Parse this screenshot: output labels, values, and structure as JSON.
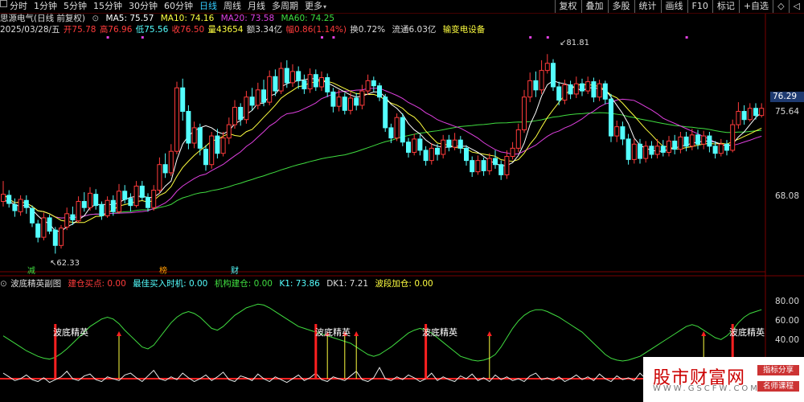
{
  "toolbar": {
    "periods": [
      "分时",
      "1分钟",
      "5分钟",
      "15分钟",
      "30分钟",
      "60分钟",
      "日线",
      "周线",
      "月线",
      "多周期",
      "更多"
    ],
    "active_period": "日线",
    "tools": [
      "复权",
      "叠加",
      "多股",
      "统计",
      "画线",
      "F10",
      "标记",
      "+自选",
      "◇",
      "◁"
    ]
  },
  "stock": {
    "name_line": "思源电气(日线 前复权)",
    "ma5_label": "MA5: 75.57",
    "ma10_label": "MA10: 74.16",
    "ma20_label": "MA20: 73.58",
    "ma60_label": "MA60: 74.25",
    "date": "2025/03/28/五",
    "open": "开75.78",
    "high": "高76.96",
    "low": "低75.56",
    "close": "收76.50",
    "volume": "量43654",
    "amount": "额3.34亿",
    "change": "幅0.86(1.14%)",
    "turnover": "换0.72%",
    "float_cap": "流通6.03亿",
    "sector": "输变电设备"
  },
  "main_axis": {
    "labels": [
      "75.64",
      "68.08"
    ],
    "current_price": "76.29"
  },
  "annotations": {
    "high_label": "81.81",
    "low_label": "62.33",
    "markers": [
      "减",
      "榜",
      "财"
    ]
  },
  "sub_panel": {
    "title": "波底精英副图",
    "items": [
      "建仓买点: 0.00",
      "最佳买入时机: 0.00",
      "机构建仓: 0.00",
      "K1: 73.86",
      "DK1: 7.21",
      "波段加仓: 0.00"
    ],
    "axis_labels": [
      "80.00",
      "60.00",
      "40.00"
    ],
    "signal_label": "波底精英"
  },
  "watermark": {
    "title": "股市财富网",
    "url": "WWW.GSCFW.COM",
    "badge1": "指标分享",
    "badge2": "名师课程"
  },
  "colors": {
    "up": "#ff3b3b",
    "down": "#54ffff",
    "ma5": "#ffffff",
    "ma10": "#ffff40",
    "ma20": "#e040e0",
    "ma60": "#40dd40"
  },
  "chart_data": {
    "type": "candlestick",
    "y_range_main": [
      61,
      83
    ],
    "y_range_sub": [
      0,
      100
    ],
    "candles": [
      [
        67.4,
        68.1,
        69.4,
        66.9
      ],
      [
        68.0,
        67.2,
        68.5,
        66.8
      ],
      [
        67.1,
        66.5,
        67.7,
        65.9
      ],
      [
        66.4,
        67.6,
        68.0,
        66.0
      ],
      [
        67.5,
        66.8,
        68.0,
        66.2
      ],
      [
        66.7,
        65.3,
        67.0,
        64.9
      ],
      [
        65.2,
        63.9,
        65.6,
        63.4
      ],
      [
        63.9,
        65.8,
        66.3,
        63.6
      ],
      [
        65.8,
        64.5,
        66.1,
        64.2
      ],
      [
        64.6,
        63.1,
        64.9,
        62.3
      ],
      [
        63.1,
        64.8,
        65.1,
        62.8
      ],
      [
        64.9,
        66.2,
        66.8,
        64.6
      ],
      [
        66.1,
        65.6,
        66.9,
        65.1
      ],
      [
        65.5,
        67.4,
        67.9,
        65.3
      ],
      [
        67.4,
        66.8,
        68.3,
        66.4
      ],
      [
        66.8,
        68.2,
        68.8,
        66.5
      ],
      [
        68.1,
        67.0,
        68.6,
        66.6
      ],
      [
        67.1,
        66.0,
        67.4,
        65.6
      ],
      [
        66.0,
        67.5,
        67.9,
        65.8
      ],
      [
        67.5,
        66.4,
        68.0,
        66.0
      ],
      [
        66.4,
        68.4,
        69.1,
        66.2
      ],
      [
        68.4,
        67.6,
        69.0,
        67.2
      ],
      [
        67.7,
        67.0,
        68.2,
        66.4
      ],
      [
        67.0,
        68.9,
        69.4,
        66.8
      ],
      [
        68.9,
        67.8,
        69.4,
        67.5
      ],
      [
        67.8,
        66.8,
        68.2,
        66.4
      ],
      [
        66.8,
        68.5,
        69.0,
        66.5
      ],
      [
        68.5,
        71.0,
        71.7,
        68.2
      ],
      [
        71.0,
        70.2,
        72.1,
        69.7
      ],
      [
        70.2,
        72.3,
        73.0,
        69.9
      ],
      [
        72.3,
        78.5,
        79.1,
        72.0
      ],
      [
        78.5,
        76.2,
        79.4,
        75.3
      ],
      [
        76.2,
        73.1,
        76.8,
        72.5
      ],
      [
        73.1,
        74.6,
        75.2,
        72.6
      ],
      [
        74.6,
        72.6,
        75.0,
        71.9
      ],
      [
        72.5,
        71.0,
        72.9,
        70.4
      ],
      [
        71.0,
        73.8,
        74.2,
        70.6
      ],
      [
        73.8,
        72.1,
        74.5,
        71.6
      ],
      [
        72.1,
        73.6,
        74.2,
        71.8
      ],
      [
        73.6,
        74.9,
        75.6,
        73.0
      ],
      [
        74.9,
        76.6,
        77.3,
        74.5
      ],
      [
        76.6,
        75.4,
        77.0,
        74.8
      ],
      [
        75.4,
        77.6,
        78.2,
        75.0
      ],
      [
        77.6,
        76.8,
        78.5,
        76.3
      ],
      [
        76.8,
        78.3,
        79.0,
        76.4
      ],
      [
        78.3,
        77.1,
        79.3,
        76.7
      ],
      [
        77.1,
        79.6,
        80.2,
        76.8
      ],
      [
        79.6,
        78.2,
        80.3,
        77.7
      ],
      [
        78.2,
        80.4,
        81.0,
        77.9
      ],
      [
        80.4,
        79.0,
        81.2,
        78.5
      ],
      [
        79.0,
        80.1,
        80.8,
        78.6
      ],
      [
        80.1,
        79.2,
        80.6,
        78.4
      ],
      [
        79.2,
        78.4,
        79.8,
        77.9
      ],
      [
        78.4,
        79.8,
        80.4,
        78.0
      ],
      [
        79.8,
        78.6,
        80.3,
        78.2
      ],
      [
        78.6,
        79.5,
        80.1,
        78.2
      ],
      [
        79.5,
        78.1,
        79.9,
        77.6
      ],
      [
        78.1,
        76.7,
        78.5,
        76.1
      ],
      [
        76.7,
        77.6,
        78.3,
        76.2
      ],
      [
        77.6,
        76.3,
        78.0,
        75.9
      ],
      [
        76.3,
        77.5,
        78.1,
        75.9
      ],
      [
        77.5,
        76.8,
        78.0,
        76.3
      ],
      [
        76.8,
        78.2,
        78.8,
        76.4
      ],
      [
        78.2,
        79.2,
        79.8,
        77.8
      ],
      [
        79.2,
        78.7,
        79.6,
        78.1
      ],
      [
        78.7,
        77.6,
        79.0,
        77.2
      ],
      [
        77.6,
        74.6,
        77.9,
        74.2
      ],
      [
        74.6,
        73.6,
        75.0,
        73.1
      ],
      [
        73.6,
        75.6,
        76.0,
        73.3
      ],
      [
        75.6,
        73.2,
        76.0,
        72.8
      ],
      [
        73.2,
        72.2,
        73.6,
        71.7
      ],
      [
        72.2,
        73.5,
        74.0,
        71.9
      ],
      [
        73.5,
        72.4,
        73.9,
        71.9
      ],
      [
        72.4,
        71.4,
        72.8,
        70.9
      ],
      [
        71.4,
        72.6,
        73.1,
        71.0
      ],
      [
        72.6,
        72.0,
        73.0,
        71.4
      ],
      [
        72.0,
        73.4,
        73.9,
        71.6
      ],
      [
        73.4,
        72.7,
        73.9,
        72.3
      ],
      [
        72.7,
        73.4,
        74.1,
        72.4
      ],
      [
        73.4,
        72.6,
        73.8,
        72.1
      ],
      [
        72.6,
        71.4,
        72.9,
        70.9
      ],
      [
        71.4,
        70.3,
        71.8,
        69.8
      ],
      [
        70.3,
        71.4,
        71.9,
        70.0
      ],
      [
        71.4,
        70.4,
        71.7,
        69.9
      ],
      [
        70.4,
        71.6,
        72.1,
        70.0
      ],
      [
        71.6,
        71.0,
        72.4,
        70.6
      ],
      [
        71.0,
        70.0,
        71.4,
        69.5
      ],
      [
        70.0,
        71.8,
        72.4,
        69.6
      ],
      [
        71.8,
        72.6,
        73.2,
        71.5
      ],
      [
        72.6,
        74.4,
        75.0,
        72.2
      ],
      [
        74.4,
        77.6,
        78.3,
        74.1
      ],
      [
        77.6,
        79.2,
        80.0,
        77.1
      ],
      [
        79.2,
        78.3,
        80.1,
        77.6
      ],
      [
        78.3,
        80.2,
        81.2,
        77.9
      ],
      [
        80.2,
        80.9,
        81.8,
        79.9
      ],
      [
        80.9,
        78.6,
        81.3,
        78.2
      ],
      [
        78.6,
        77.3,
        79.1,
        76.8
      ],
      [
        77.3,
        78.8,
        79.3,
        76.9
      ],
      [
        78.8,
        77.9,
        79.2,
        77.4
      ],
      [
        77.9,
        78.9,
        79.6,
        77.5
      ],
      [
        78.9,
        78.2,
        79.4,
        77.7
      ],
      [
        78.2,
        79.1,
        79.6,
        77.9
      ],
      [
        79.1,
        77.6,
        79.5,
        77.1
      ],
      [
        77.6,
        78.9,
        79.3,
        77.2
      ],
      [
        78.9,
        77.4,
        79.2,
        76.9
      ],
      [
        77.4,
        73.8,
        77.9,
        73.2
      ],
      [
        73.8,
        74.7,
        75.3,
        73.2
      ],
      [
        74.7,
        73.5,
        75.2,
        72.9
      ],
      [
        73.5,
        71.5,
        74.0,
        71.0
      ],
      [
        71.5,
        73.0,
        73.5,
        71.1
      ],
      [
        73.0,
        71.6,
        73.5,
        71.1
      ],
      [
        71.6,
        72.8,
        73.3,
        71.2
      ],
      [
        72.8,
        72.0,
        73.3,
        71.6
      ],
      [
        72.0,
        72.8,
        73.5,
        71.6
      ],
      [
        72.8,
        72.2,
        73.4,
        71.8
      ],
      [
        72.2,
        73.3,
        73.8,
        71.8
      ],
      [
        73.3,
        72.5,
        73.9,
        72.0
      ],
      [
        72.5,
        73.7,
        74.2,
        72.1
      ],
      [
        73.7,
        72.8,
        74.2,
        72.3
      ],
      [
        72.8,
        73.9,
        74.5,
        72.4
      ],
      [
        73.9,
        73.0,
        74.4,
        72.5
      ],
      [
        73.0,
        73.8,
        74.3,
        72.5
      ],
      [
        73.8,
        72.8,
        74.2,
        72.2
      ],
      [
        72.8,
        72.1,
        73.3,
        71.6
      ],
      [
        72.1,
        73.0,
        73.5,
        71.8
      ],
      [
        73.0,
        72.4,
        73.4,
        71.9
      ],
      [
        72.4,
        74.9,
        75.4,
        72.2
      ],
      [
        74.9,
        76.2,
        77.1,
        74.5
      ],
      [
        76.2,
        75.4,
        76.8,
        74.9
      ],
      [
        75.4,
        76.5,
        77.0,
        75.2
      ],
      [
        76.5,
        75.8,
        77.0,
        75.4
      ],
      [
        75.8,
        76.5,
        77.0,
        75.6
      ]
    ],
    "ma5": [
      67.5,
      67.4,
      67.1,
      66.9,
      67.1,
      66.6,
      66.0,
      65.5,
      65.2,
      64.5,
      64.5,
      64.9,
      65.2,
      65.6,
      66.0,
      66.8,
      67.1,
      67.1,
      67.1,
      67.1,
      67.3,
      67.6,
      67.8,
      67.9,
      67.9,
      67.8,
      67.8,
      68.2,
      68.9,
      69.4,
      71.5,
      73.0,
      73.8,
      74.3,
      74.6,
      74.8,
      74.6,
      74.2,
      74.0,
      74.3,
      75.0,
      75.3,
      75.9,
      76.3,
      77.0,
      77.0,
      77.7,
      77.9,
      78.6,
      78.9,
      79.1,
      79.2,
      79.3,
      79.4,
      79.4,
      79.2,
      79.0,
      78.7,
      78.4,
      78.1,
      77.8,
      77.6,
      77.7,
      77.9,
      78.1,
      78.1,
      77.6,
      76.9,
      76.5,
      75.9,
      75.0,
      74.4,
      74.0,
      73.4,
      73.0,
      72.8,
      72.7,
      72.7,
      72.8,
      72.8,
      72.8,
      72.5,
      72.2,
      71.8,
      71.4,
      71.1,
      70.9,
      70.9,
      71.2,
      71.9,
      73.1,
      74.9,
      76.1,
      77.7,
      78.8,
      79.2,
      79.0,
      78.9,
      78.7,
      78.5,
      78.2,
      78.5,
      78.5,
      78.4,
      78.3,
      77.6,
      76.8,
      76.0,
      75.0,
      73.6,
      72.9,
      72.6,
      72.4,
      72.3,
      72.3,
      72.5,
      72.6,
      72.8,
      72.9,
      73.1,
      73.2,
      73.3,
      73.3,
      73.2,
      73.0,
      72.8,
      73.0,
      73.7,
      74.2,
      74.9,
      75.6,
      76.1
    ],
    "k1": [
      52,
      48,
      44,
      40,
      36,
      33,
      30,
      28,
      27,
      29,
      33,
      38,
      44,
      50,
      56,
      62,
      66,
      70,
      72,
      70,
      65,
      58,
      52,
      46,
      40,
      38,
      42,
      50,
      58,
      66,
      72,
      76,
      78,
      76,
      72,
      66,
      60,
      58,
      62,
      68,
      74,
      78,
      82,
      84,
      86,
      85,
      82,
      78,
      74,
      70,
      66,
      62,
      60,
      58,
      56,
      54,
      52,
      50,
      48,
      46,
      44,
      40,
      36,
      32,
      30,
      32,
      36,
      40,
      45,
      50,
      55,
      58,
      60,
      58,
      55,
      50,
      45,
      40,
      35,
      30,
      28,
      26,
      25,
      26,
      28,
      32,
      40,
      50,
      60,
      68,
      74,
      78,
      80,
      80,
      78,
      75,
      72,
      68,
      64,
      60,
      56,
      50,
      44,
      38,
      32,
      28,
      26,
      25,
      26,
      28,
      30,
      34,
      38,
      42,
      46,
      50,
      54,
      58,
      62,
      64,
      62,
      58,
      54,
      50,
      48,
      52,
      58,
      66,
      72,
      76,
      78,
      80
    ],
    "dk1": [
      12,
      8,
      4,
      6,
      10,
      5,
      3,
      7,
      2,
      5,
      8,
      14,
      6,
      4,
      9,
      11,
      5,
      3,
      8,
      6,
      4,
      10,
      12,
      7,
      3,
      9,
      15,
      6,
      4,
      8,
      5,
      12,
      7,
      3,
      6,
      10,
      4,
      8,
      13,
      5,
      3,
      9,
      7,
      4,
      11,
      6,
      3,
      8,
      5,
      2,
      6,
      10,
      4,
      7,
      12,
      5,
      3,
      8,
      6,
      4,
      9,
      14,
      5,
      3,
      7,
      18,
      6,
      4,
      8,
      5,
      10,
      7,
      3,
      6,
      12,
      4,
      8,
      5,
      3,
      9,
      6,
      11,
      4,
      7,
      3,
      10,
      5,
      8,
      4,
      6,
      3,
      9,
      12,
      5,
      7,
      4,
      8,
      3,
      6,
      10,
      5,
      8,
      4,
      11,
      6,
      3,
      9,
      5,
      7,
      4,
      12,
      6,
      3,
      8,
      5,
      10,
      4,
      7,
      3,
      9,
      6,
      12,
      5,
      8,
      4,
      7,
      15,
      6,
      3,
      9,
      5,
      8
    ]
  }
}
